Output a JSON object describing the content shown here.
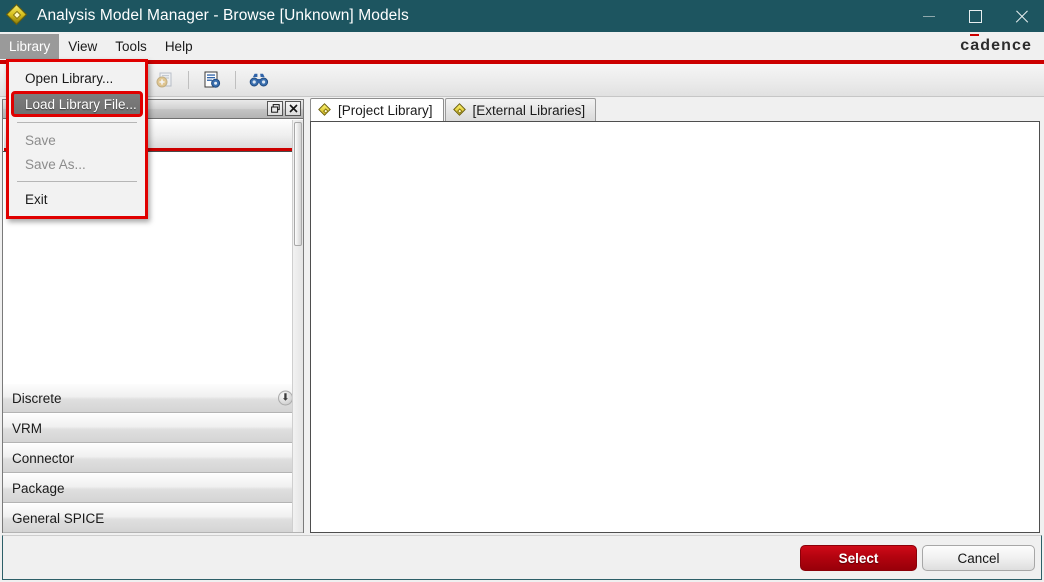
{
  "window": {
    "title": "Analysis Model Manager - Browse [Unknown] Models",
    "app_icon": "diamond-model-icon",
    "titlebar_color": "#1d5560",
    "accent_color": "#cc0000",
    "controls": {
      "minimize": "minimize-icon",
      "maximize": "maximize-icon",
      "close": "close-icon"
    }
  },
  "menubar": {
    "items": [
      {
        "label": "Library",
        "active": true
      },
      {
        "label": "View",
        "active": false
      },
      {
        "label": "Tools",
        "active": false
      },
      {
        "label": "Help",
        "active": false
      }
    ],
    "brand": {
      "pre": "c",
      "a": "a",
      "post": "dence"
    }
  },
  "dropdown": {
    "owner": "Library",
    "items": [
      {
        "label": "Open Library...",
        "state": "normal"
      },
      {
        "label": "Load Library File...",
        "state": "highlighted"
      },
      {
        "label": "__separator__",
        "state": "separator"
      },
      {
        "label": "Save",
        "state": "disabled"
      },
      {
        "label": "Save As...",
        "state": "disabled"
      },
      {
        "label": "__separator2__",
        "state": "separator"
      },
      {
        "label": "Exit",
        "state": "normal"
      }
    ]
  },
  "toolbar": {
    "buttons": [
      {
        "name": "list-view-icon",
        "enabled": true,
        "pressed": true
      },
      {
        "name": "table-view-icon",
        "enabled": true,
        "pressed": false
      },
      {
        "name": "new-model-icon",
        "enabled": false,
        "pressed": false
      },
      {
        "name": "delete-model-icon",
        "enabled": false,
        "pressed": false
      },
      {
        "name": "add-library-icon",
        "enabled": false,
        "pressed": false
      },
      {
        "name": "model-properties-icon",
        "enabled": true,
        "pressed": false
      },
      {
        "name": "find-icon",
        "enabled": true,
        "pressed": false
      }
    ]
  },
  "left_panel": {
    "float_button": "restore-window-icon",
    "close_button": "close-panel-icon",
    "search_placeholder": "",
    "categories": [
      {
        "label": "Discrete",
        "expandable": true,
        "arrow": "⬇"
      },
      {
        "label": "VRM",
        "expandable": false
      },
      {
        "label": "Connector",
        "expandable": false
      },
      {
        "label": "Package",
        "expandable": false
      },
      {
        "label": "General SPICE",
        "expandable": false
      }
    ]
  },
  "tabs": [
    {
      "label": "[Project Library]",
      "active": true,
      "icon": "diamond-model-icon"
    },
    {
      "label": "[External Libraries]",
      "active": false,
      "icon": "diamond-model-icon"
    }
  ],
  "footer": {
    "select_label": "Select",
    "cancel_label": "Cancel",
    "select_color": "#b3030f"
  }
}
